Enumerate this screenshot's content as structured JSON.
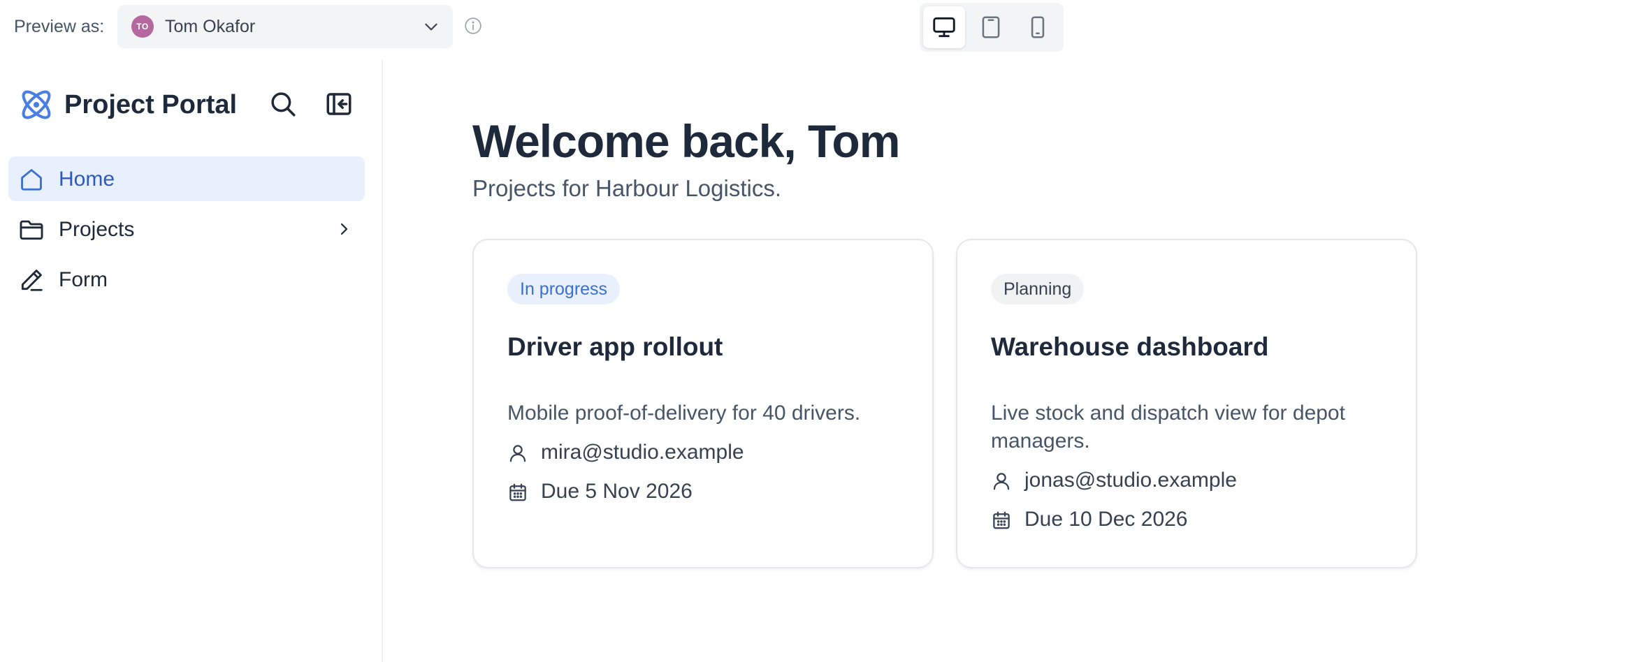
{
  "preview_bar": {
    "label": "Preview as:",
    "selected_user": {
      "initials": "TO",
      "name": "Tom Okafor",
      "avatar_color": "#b5679f"
    },
    "devices": [
      {
        "icon": "desktop-icon",
        "active": true
      },
      {
        "icon": "tablet-icon",
        "active": false
      },
      {
        "icon": "mobile-icon",
        "active": false
      }
    ]
  },
  "sidebar": {
    "brand": "Project Portal",
    "items": [
      {
        "label": "Home",
        "icon": "home-icon",
        "active": true
      },
      {
        "label": "Projects",
        "icon": "folder-icon",
        "active": false,
        "has_submenu": true
      },
      {
        "label": "Form",
        "icon": "pen-icon",
        "active": false
      }
    ]
  },
  "main": {
    "title": "Welcome back, Tom",
    "subtitle": "Projects for Harbour Logistics.",
    "cards": [
      {
        "status": "In progress",
        "title": "Driver app rollout",
        "description": "Mobile proof-of-delivery for 40 drivers.",
        "owner": "mira@studio.example",
        "due": "Due 5 Nov 2026"
      },
      {
        "status": "Planning",
        "title": "Warehouse dashboard",
        "description": "Live stock and dispatch view for depot managers.",
        "owner": "jonas@studio.example",
        "due": "Due 10 Dec 2026"
      }
    ]
  },
  "colors": {
    "accent": "#2f5ab9",
    "accent_light": "#e8f0fd",
    "text_dark": "#1e293b",
    "text_muted": "#475569"
  }
}
